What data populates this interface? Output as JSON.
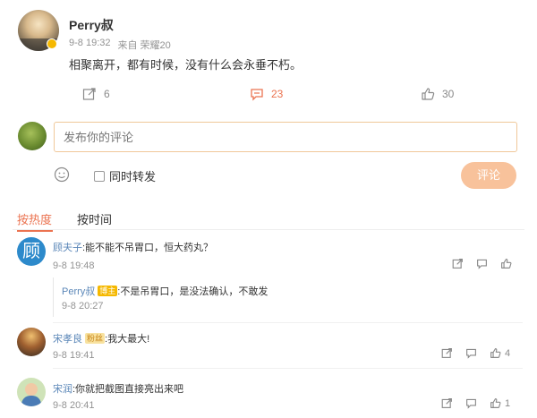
{
  "post": {
    "author": "Perry叔",
    "time": "9-8 19:32",
    "source": "来自 荣耀20",
    "text": "相聚离开，都有时候，没有什么会永垂不朽。",
    "repost_count": "6",
    "comment_count": "23",
    "like_count": "30"
  },
  "composer": {
    "placeholder": "发布你的评论",
    "repost_label": "同时转发",
    "submit_label": "评论"
  },
  "sort_tabs": {
    "hot": "按热度",
    "time": "按时间"
  },
  "comments": [
    {
      "author": "顾夫子",
      "text": ":能不能不吊胃口，恒大药丸？",
      "time": "9-8 19:48",
      "avatar_char": "顾",
      "like_count": "",
      "reply": {
        "author": "Perry叔",
        "badge": "博主",
        "text": ":不是吊胃口，是没法确认，不敢发",
        "time": "9-8 20:27"
      }
    },
    {
      "author": "宋孝良",
      "badge": "粉丝",
      "text": ":我大最大!",
      "time": "9-8 19:41",
      "like_count": "4"
    },
    {
      "author": "宋润",
      "text": ":你就把截图直接亮出来吧",
      "time": "9-8 20:41",
      "like_count": "1"
    }
  ],
  "colors": {
    "accent": "#eb7350",
    "link": "#5b87b8",
    "submit_bg": "#f8c29b",
    "input_border": "#f0c89a"
  }
}
